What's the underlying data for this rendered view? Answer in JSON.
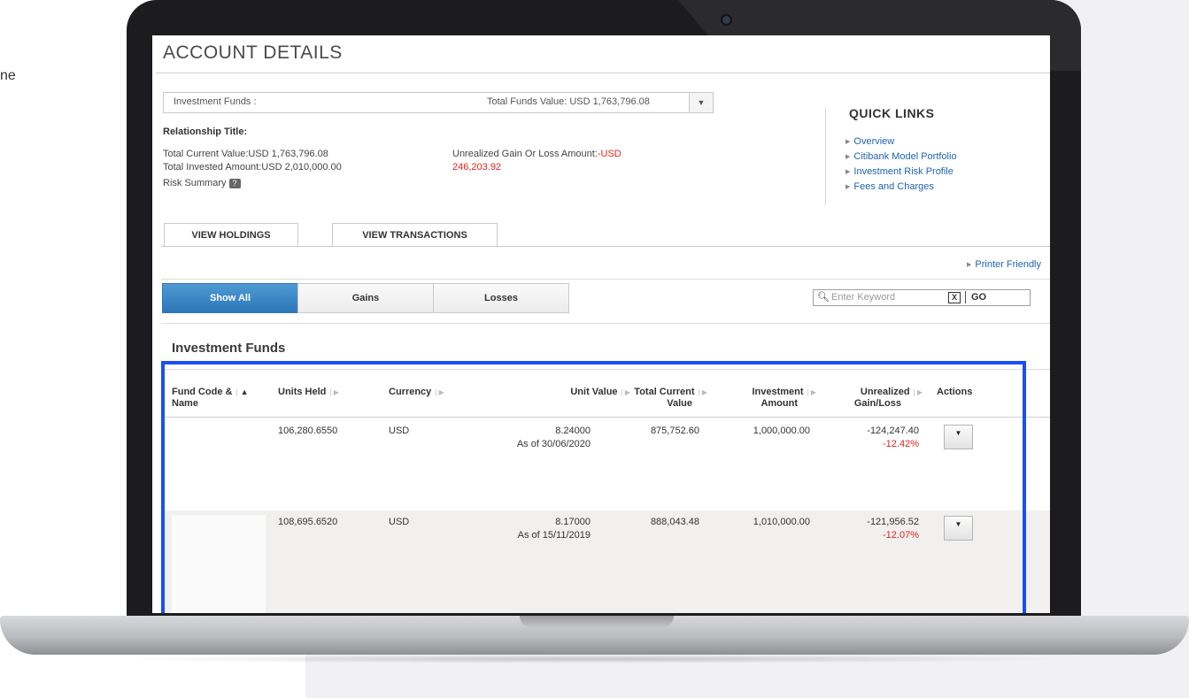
{
  "side_text": "ne",
  "page": {
    "title": "ACCOUNT DETAILS"
  },
  "fund_selector": {
    "label": "Investment Funds :",
    "value": "Total Funds Value: USD 1,763,796.08",
    "dropdown_icon": "▼"
  },
  "summary": {
    "relationship_title_label": "Relationship Title:",
    "total_current_value": "Total Current Value:USD 1,763,796.08",
    "total_invested_amount": "Total Invested Amount:USD 2,010,000.00",
    "risk_summary": "Risk Summary",
    "risk_help_icon": "?",
    "unrealized_label": "Unrealized Gain Or Loss Amount:",
    "unrealized_value_part1": "-USD",
    "unrealized_value_part2": "246,203.92"
  },
  "quick_links": {
    "title": "QUICK LINKS",
    "items": [
      "Overview",
      "Citibank Model Portfolio",
      "Investment Risk Profile",
      "Fees and Charges"
    ]
  },
  "tabs": [
    {
      "label": "VIEW HOLDINGS"
    },
    {
      "label": "VIEW TRANSACTIONS"
    }
  ],
  "printer_friendly": "Printer Friendly",
  "filters": [
    {
      "label": "Show All",
      "active": true
    },
    {
      "label": "Gains",
      "active": false
    },
    {
      "label": "Losses",
      "active": false
    }
  ],
  "search": {
    "placeholder": "Enter Keyword",
    "clear": "X",
    "go": "GO"
  },
  "section_title": "Investment Funds",
  "table": {
    "headers": {
      "fund_line1": "Fund Code &",
      "fund_line2": "Name",
      "units_held": "Units Held",
      "currency": "Currency",
      "unit_value": "Unit Value",
      "total_current_line1": "Total Current",
      "total_current_line2": "Value",
      "investment_line1": "Investment",
      "investment_line2": "Amount",
      "unrealized_line1": "Unrealized",
      "unrealized_line2": "Gain/Loss",
      "actions": "Actions"
    },
    "rows": [
      {
        "units_held": "106,280.6550",
        "currency": "USD",
        "unit_value": "8.24000",
        "as_of": "As of 30/06/2020",
        "total_current_value": "875,752.60",
        "investment_amount": "1,000,000.00",
        "gain_loss": "-124,247.40",
        "gain_loss_pct": "-12.42%"
      },
      {
        "units_held": "108,695.6520",
        "currency": "USD",
        "unit_value": "8.17000",
        "as_of": "As of 15/11/2019",
        "total_current_value": "888,043.48",
        "investment_amount": "1,010,000.00",
        "gain_loss": "-121,956.52",
        "gain_loss_pct": "-12.07%"
      }
    ]
  },
  "colors": {
    "link": "#1f64b0",
    "negative": "#e2231a",
    "active_filter": "#2c76b8",
    "highlight_border": "#1b4ff0"
  }
}
